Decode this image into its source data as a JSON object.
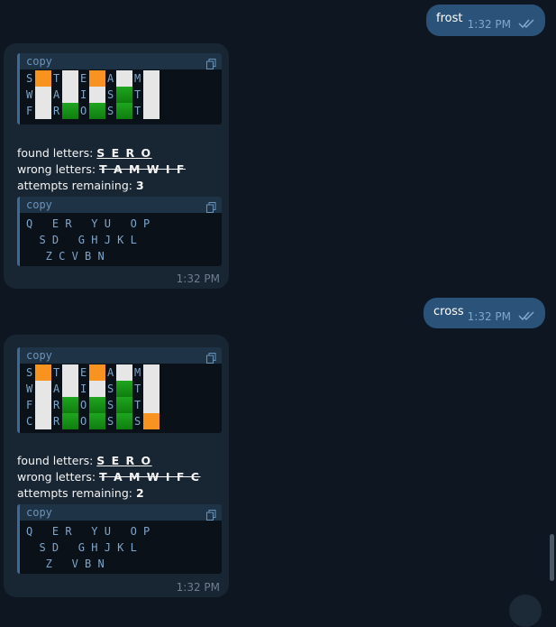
{
  "messages": {
    "out1": {
      "text": "frost",
      "time": "1:32 PM"
    },
    "in1": {
      "copy_label": "copy",
      "grid": [
        {
          "letters": [
            "S",
            "T",
            "E",
            "A",
            "M"
          ],
          "colors": [
            "orange",
            "white",
            "orange",
            "white",
            "white"
          ]
        },
        {
          "letters": [
            "W",
            "A",
            "I",
            "S",
            "T"
          ],
          "colors": [
            "white",
            "white",
            "white",
            "green",
            "white"
          ]
        },
        {
          "letters": [
            "F",
            "R",
            "O",
            "S",
            "T"
          ],
          "colors": [
            "white",
            "green",
            "green",
            "green",
            "white"
          ]
        }
      ],
      "found_label": "found letters: ",
      "found_value": "S E R O",
      "wrong_label": "wrong letters: ",
      "wrong_value": "T A M W I F",
      "attempts_label": "attempts remaining: ",
      "attempts_value": "3",
      "kb_copy_label": "copy",
      "keyboard": [
        "Q   E R   Y U   O P",
        "  S D   G H J K L",
        "   Z C V B N"
      ],
      "time": "1:32 PM"
    },
    "out2": {
      "text": "cross",
      "time": "1:32 PM"
    },
    "in2": {
      "copy_label": "copy",
      "grid": [
        {
          "letters": [
            "S",
            "T",
            "E",
            "A",
            "M"
          ],
          "colors": [
            "orange",
            "white",
            "orange",
            "white",
            "white"
          ]
        },
        {
          "letters": [
            "W",
            "A",
            "I",
            "S",
            "T"
          ],
          "colors": [
            "white",
            "white",
            "white",
            "green",
            "white"
          ]
        },
        {
          "letters": [
            "F",
            "R",
            "O",
            "S",
            "T"
          ],
          "colors": [
            "white",
            "green",
            "green",
            "green",
            "white"
          ]
        },
        {
          "letters": [
            "C",
            "R",
            "O",
            "S",
            "S"
          ],
          "colors": [
            "white",
            "green",
            "green",
            "green",
            "orange"
          ]
        }
      ],
      "found_label": "found letters: ",
      "found_value": "S E R O",
      "wrong_label": "wrong letters: ",
      "wrong_value": "T A M W I F C",
      "attempts_label": "attempts remaining: ",
      "attempts_value": "2",
      "kb_copy_label": "copy",
      "keyboard": [
        "Q   E R   Y U   O P",
        "  S D   G H J K L",
        "   Z   V B N"
      ],
      "time": "1:32 PM"
    }
  },
  "colors": {
    "white": "#e6e6e6",
    "orange": "#f7931e",
    "green": "#1a9a1a"
  }
}
